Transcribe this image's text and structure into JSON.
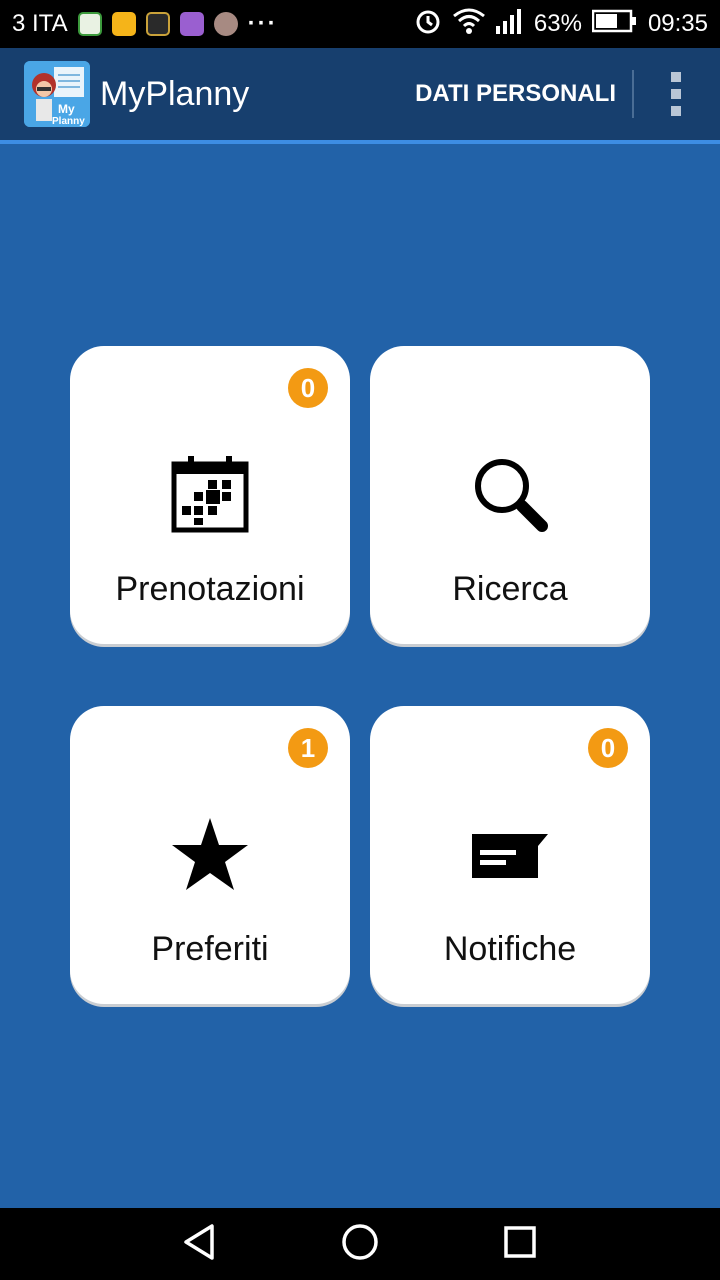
{
  "status_bar": {
    "carrier": "3 ITA",
    "more": "···",
    "battery": "63%",
    "time": "09:35",
    "notification_icons": [
      "app-icon-green",
      "app-icon-yellow",
      "app-icon-dark",
      "app-icon-purple",
      "app-icon-s"
    ]
  },
  "appbar": {
    "title": "MyPlanny",
    "action_label": "DATI PERSONALI",
    "overflow_icon": "overflow-menu-icon"
  },
  "tiles": [
    {
      "label": "Prenotazioni",
      "badge": "0",
      "icon": "calendar-icon"
    },
    {
      "label": "Ricerca",
      "badge": null,
      "icon": "search-icon"
    },
    {
      "label": "Preferiti",
      "badge": "1",
      "icon": "star-icon"
    },
    {
      "label": "Notifiche",
      "badge": "0",
      "icon": "message-icon"
    }
  ],
  "colors": {
    "background": "#2262a8",
    "appbar": "#173f6e",
    "badge": "#f39a13",
    "accent_line": "#3d8de3"
  },
  "navbar": {
    "icons": [
      "back-icon",
      "home-icon",
      "recents-icon"
    ]
  }
}
